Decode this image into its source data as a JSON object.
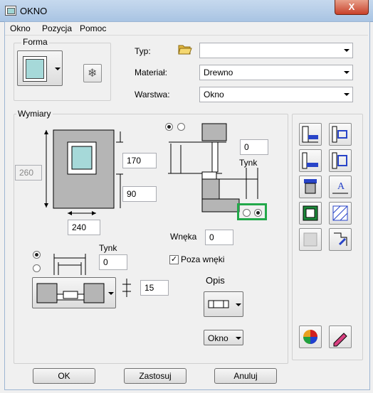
{
  "window": {
    "title": "OKNO",
    "close_glyph": "X"
  },
  "menu": {
    "items": [
      "Okno",
      "Pozycja",
      "Pomoc"
    ]
  },
  "forma": {
    "label": "Forma"
  },
  "properties": {
    "typ_label": "Typ:",
    "typ_value": "",
    "material_label": "Materiał:",
    "material_value": "Drewno",
    "warstwa_label": "Warstwa:",
    "warstwa_value": "Okno"
  },
  "wymiary": {
    "label": "Wymiary",
    "width_disabled": "260",
    "top_value": "170",
    "bottom_value": "90",
    "width_value": "240",
    "right_offset": "0",
    "tynk_label": "Tynk",
    "wneka_label": "Wnęka",
    "wneka_value": "0",
    "poza_wneki_label": "Poza wnęki",
    "poza_wneki_checked": true,
    "tynk2_label": "Tynk",
    "tynk2_value": "0",
    "depth_value": "15",
    "opis_label": "Opis",
    "opis_select": "Okno"
  },
  "buttons": {
    "ok": "OK",
    "apply": "Zastosuj",
    "cancel": "Anuluj"
  },
  "colors": {
    "highlight": "#22a84a",
    "window_glass": "#a6d9d9",
    "wall": "#b5b5b5"
  }
}
